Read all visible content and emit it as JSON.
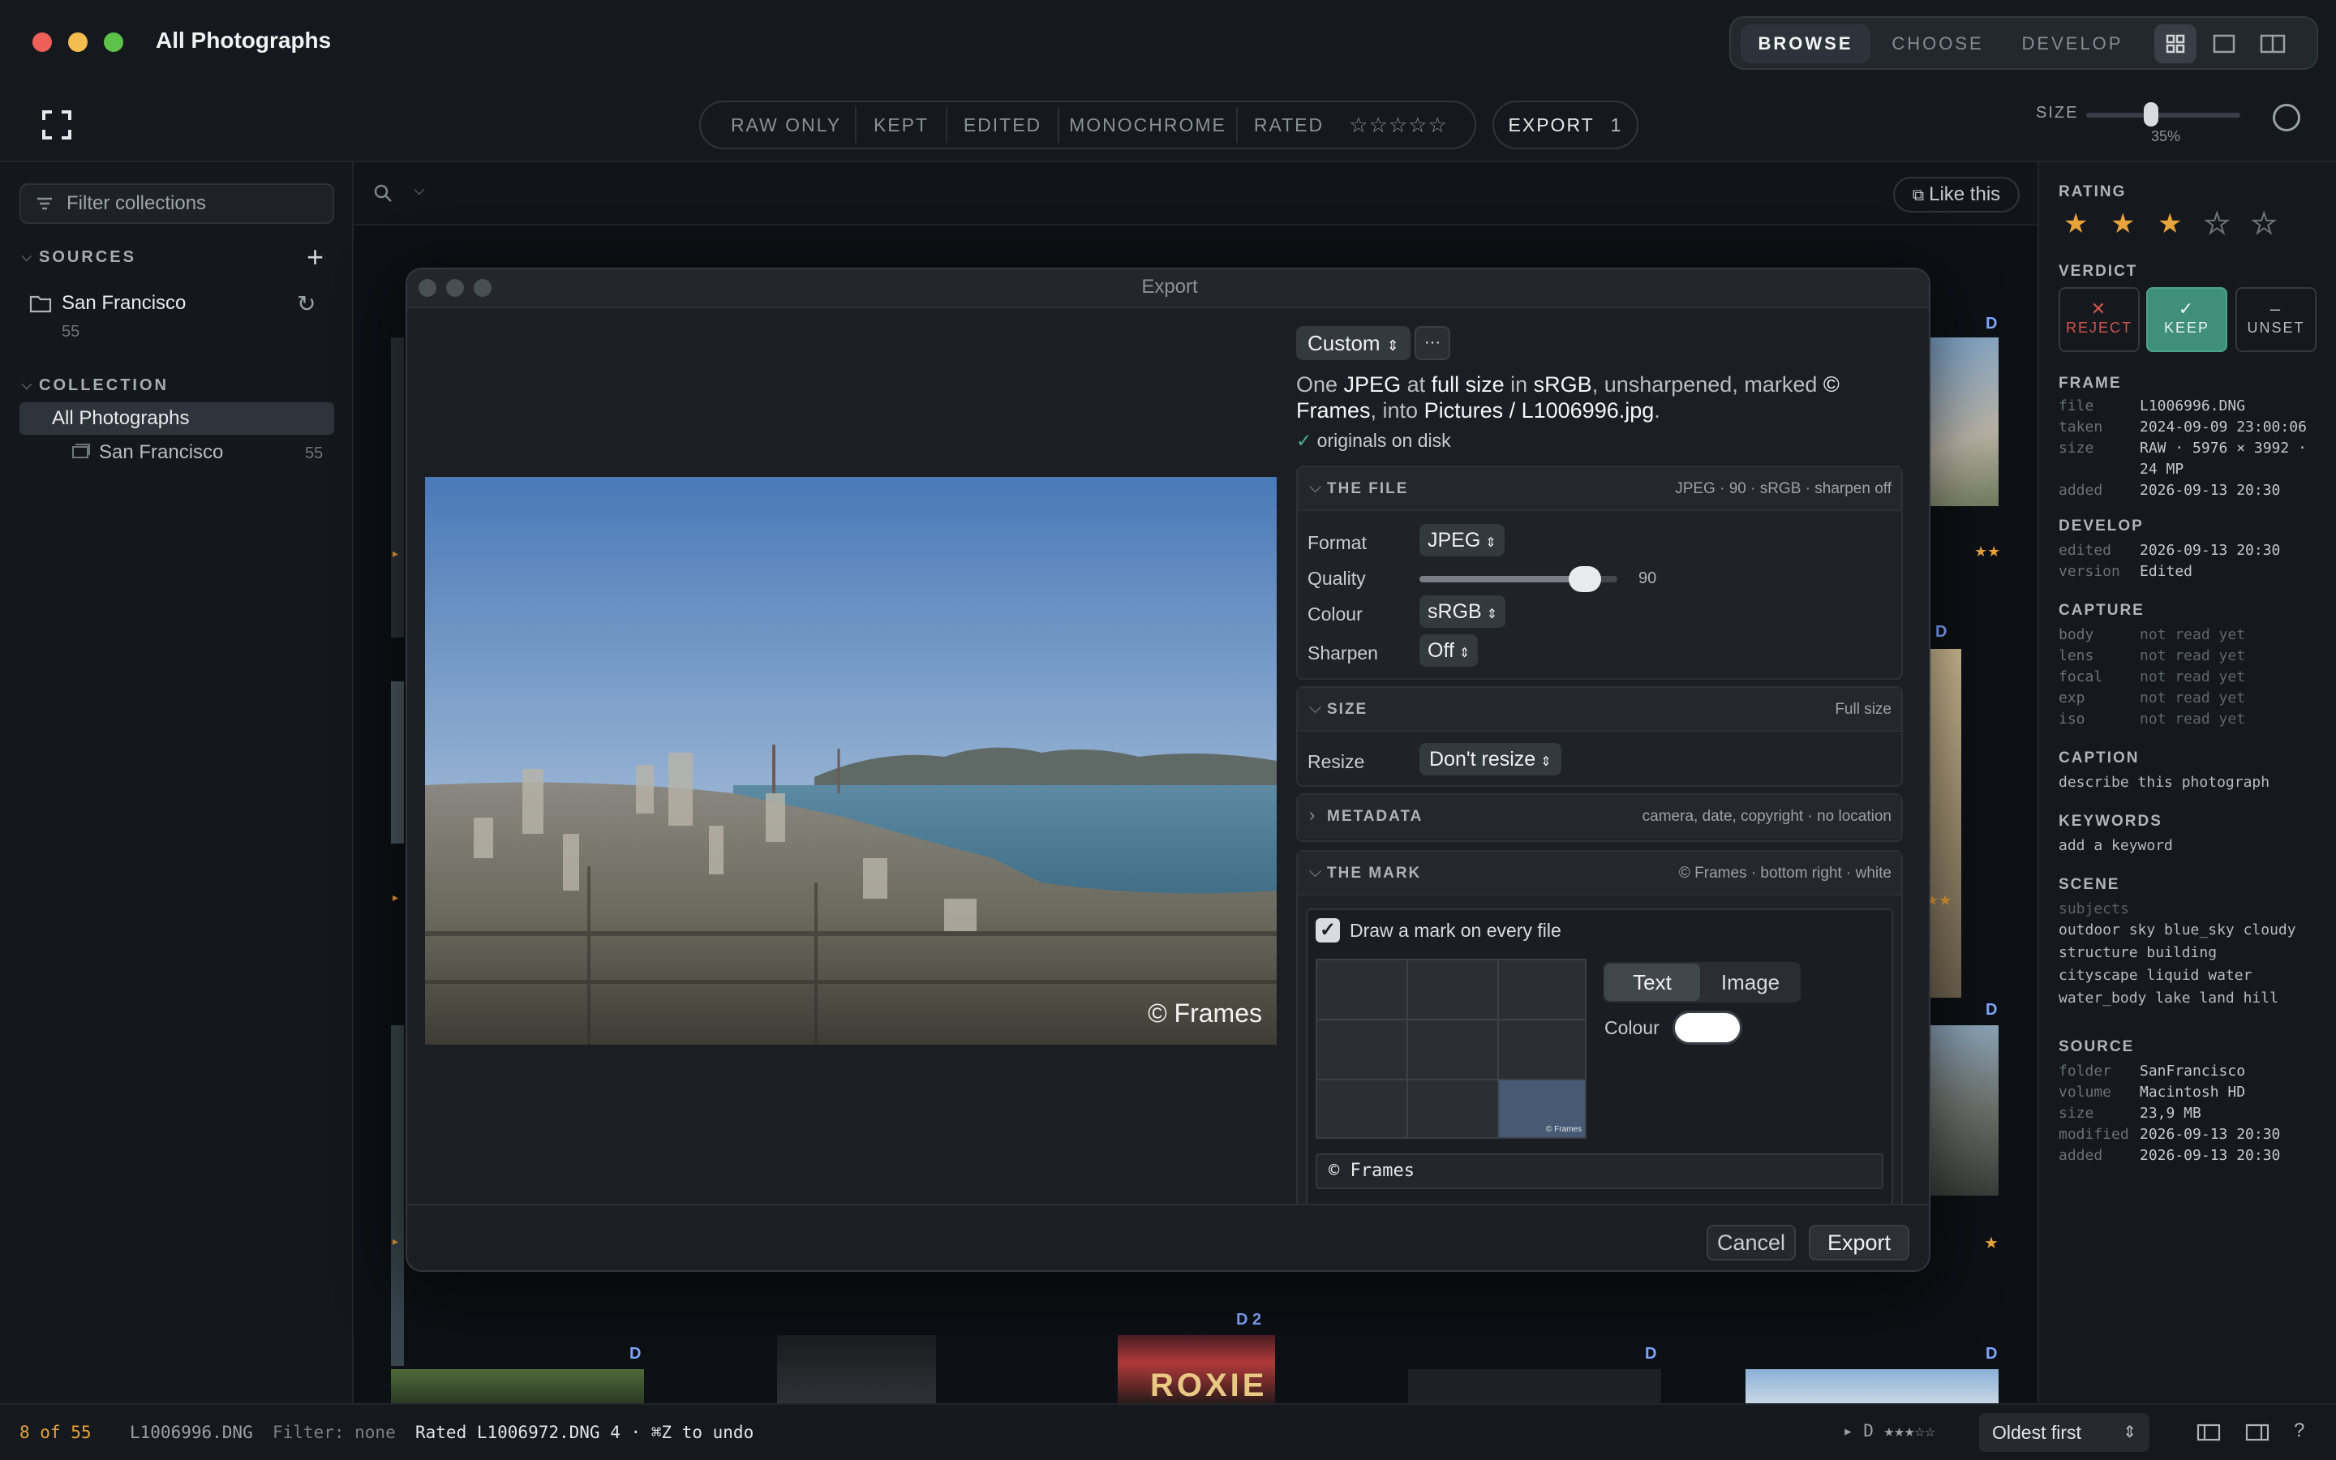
{
  "window": {
    "title": "All Photographs"
  },
  "modes": [
    "BROWSE",
    "CHOOSE",
    "DEVELOP"
  ],
  "toolbar": {
    "filters": [
      "RAW ONLY",
      "KEPT",
      "EDITED",
      "MONOCHROME",
      "RATED"
    ],
    "rated_stars": "☆☆☆☆☆",
    "export_label": "EXPORT",
    "export_count": "1",
    "size_label": "SIZE",
    "size_value": "35%",
    "size_fraction": 0.35
  },
  "sidebar": {
    "filter_placeholder": "Filter collections",
    "sources_head": "SOURCES",
    "source_name": "San Francisco",
    "source_count": "55",
    "collection_head": "COLLECTION",
    "collection_all": "All Photographs",
    "collection_child": "San Francisco",
    "collection_child_count": "55"
  },
  "main": {
    "like_this": "Like this",
    "grid_badges": {
      "d": "D",
      "d2": "D 2",
      "stars2": "★★",
      "star1": "★"
    }
  },
  "right": {
    "rating_head": "RATING",
    "rating": 3,
    "verdict_head": "VERDICT",
    "reject": "REJECT",
    "keep": "KEEP",
    "unset": "UNSET",
    "frame_head": "FRAME",
    "frame": [
      [
        "file",
        "L1006996.DNG"
      ],
      [
        "taken",
        "2024-09-09 23:00:06"
      ],
      [
        "size",
        "RAW · 5976 × 3992 ·"
      ],
      [
        "",
        "24 MP"
      ],
      [
        "added",
        "2026-09-13 20:30"
      ]
    ],
    "develop_head": "DEVELOP",
    "develop": [
      [
        "edited",
        "2026-09-13 20:30"
      ],
      [
        "version",
        "Edited"
      ]
    ],
    "capture_head": "CAPTURE",
    "capture": [
      [
        "body",
        "not read yet"
      ],
      [
        "lens",
        "not read yet"
      ],
      [
        "focal",
        "not read yet"
      ],
      [
        "exp",
        "not read yet"
      ],
      [
        "iso",
        "not read yet"
      ]
    ],
    "caption_head": "CAPTION",
    "caption": "describe this photograph",
    "keywords_head": "KEYWORDS",
    "keywords": "add a keyword",
    "scene_head": "SCENE",
    "scene_sub": "subjects",
    "scene_lines": [
      "outdoor sky blue_sky cloudy",
      "structure building",
      "cityscape liquid water",
      "water_body lake land hill"
    ],
    "source_head": "SOURCE",
    "source": [
      [
        "folder",
        "SanFrancisco"
      ],
      [
        "volume",
        "Macintosh HD"
      ],
      [
        "size",
        "23,9 MB"
      ],
      [
        "modified",
        "2026-09-13 20:30"
      ],
      [
        "added",
        "2026-09-13 20:30"
      ]
    ]
  },
  "status": {
    "position": "8 of 55",
    "file": "L1006996.DNG",
    "filter": "Filter: none",
    "message": "Rated L1006972.DNG 4 · ⌘Z to undo",
    "badge": "▸ D ★★★☆☆",
    "sort": "Oldest first"
  },
  "dialog": {
    "title": "Export",
    "preset": "Custom",
    "more": "···",
    "summary_parts": [
      "One ",
      "JPEG",
      " at ",
      "full size",
      " in ",
      "sRGB",
      ", unsharpened, marked ",
      "© Frames",
      ", into ",
      "Pictures / L1006996.jpg",
      "."
    ],
    "originals": "originals on disk",
    "file_section": {
      "title": "THE FILE",
      "summary": "JPEG · 90 · sRGB · sharpen off",
      "format_label": "Format",
      "format": "JPEG",
      "quality_label": "Quality",
      "quality": 90,
      "colour_label": "Colour",
      "colour": "sRGB",
      "sharpen_label": "Sharpen",
      "sharpen": "Off"
    },
    "size_section": {
      "title": "SIZE",
      "summary": "Full size",
      "resize_label": "Resize",
      "resize": "Don't resize"
    },
    "metadata_section": {
      "title": "METADATA",
      "summary": "camera, date, copyright · no location"
    },
    "mark_section": {
      "title": "THE MARK",
      "summary": "© Frames · bottom right · white",
      "draw_label": "Draw a mark on every file",
      "tab_text": "Text",
      "tab_image": "Image",
      "colour_label": "Colour",
      "mark_text": "© Frames",
      "mini_mark": "© Frames"
    },
    "watermark": "© Frames",
    "cancel": "Cancel",
    "export": "Export"
  },
  "colors": {
    "accent_keep": "#3f8f7c",
    "star": "#e8a23a",
    "badge_blue": "#7fa6ff",
    "status_orange": "#e8a23a"
  },
  "icons": {
    "filter": "filter-icon",
    "plus": "plus-icon",
    "folder": "folder-icon",
    "refresh": "refresh-icon",
    "search": "search-icon"
  }
}
